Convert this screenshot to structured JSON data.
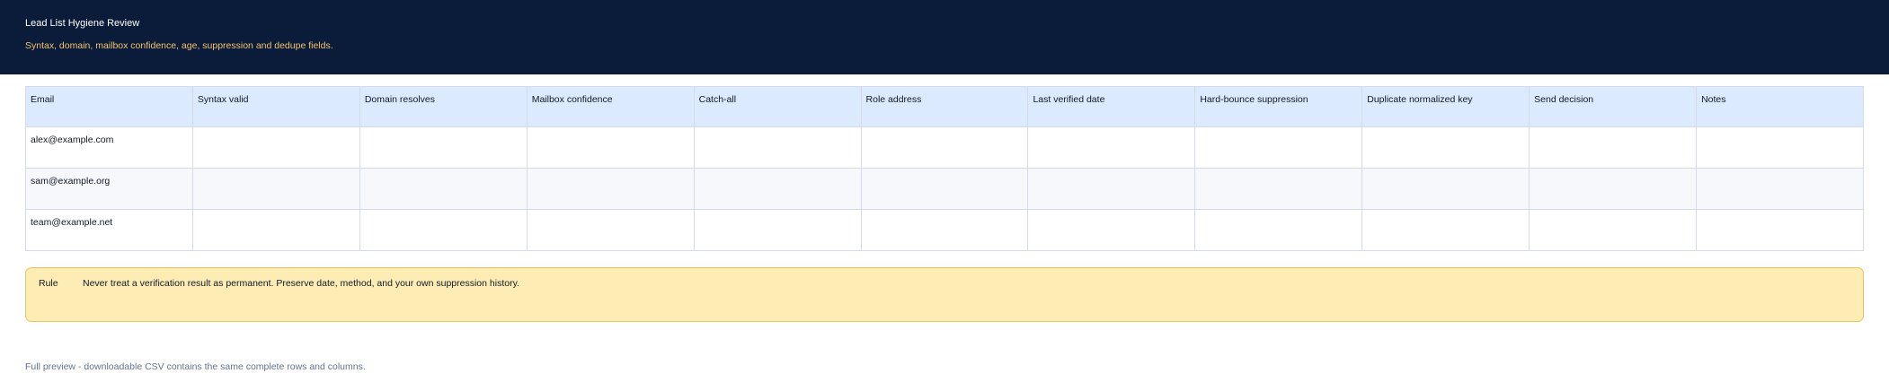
{
  "header": {
    "title": "Lead List Hygiene Review",
    "subtitle": "Syntax, domain, mailbox confidence, age, suppression and dedupe fields."
  },
  "table": {
    "columns": [
      "Email",
      "Syntax valid",
      "Domain resolves",
      "Mailbox confidence",
      "Catch-all",
      "Role address",
      "Last verified date",
      "Hard-bounce suppression",
      "Duplicate normalized key",
      "Send decision",
      "Notes"
    ],
    "rows": [
      [
        "alex@example.com",
        "",
        "",
        "",
        "",
        "",
        "",
        "",
        "",
        "",
        ""
      ],
      [
        "sam@example.org",
        "",
        "",
        "",
        "",
        "",
        "",
        "",
        "",
        "",
        ""
      ],
      [
        "team@example.net",
        "",
        "",
        "",
        "",
        "",
        "",
        "",
        "",
        "",
        ""
      ]
    ]
  },
  "rule": {
    "label": "Rule",
    "text": "Never treat a verification result as permanent. Preserve date, method, and your own suppression history."
  },
  "footer": {
    "text": "Full preview - downloadable CSV contains the same complete rows and columns."
  },
  "colors": {
    "header_bg": "#0b1b3a",
    "subtitle": "#f2c46d",
    "table_header_bg": "#dbeafe",
    "rule_bg": "#fdedb5",
    "rule_border": "#e8c55c"
  }
}
